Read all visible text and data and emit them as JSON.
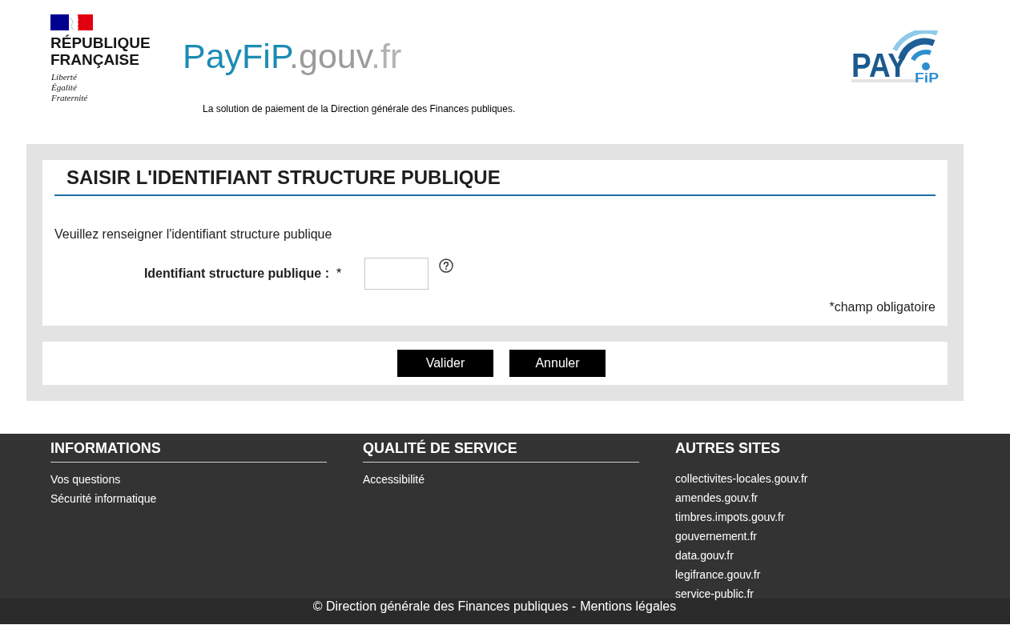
{
  "header": {
    "emblem": {
      "name_lines": [
        "RÉPUBLIQUE",
        "FRANÇAISE"
      ],
      "motto_lines": [
        "Liberté",
        "Égalité",
        "Fraternité"
      ]
    },
    "wordmark": [
      {
        "text": "PayFiP",
        "color": "#1b8cb3"
      },
      {
        "text": ".gouv",
        "color": "#9b9b9b"
      },
      {
        "text": ".fr",
        "color": "#b3b3b3"
      }
    ],
    "tagline": "La solution de paiement de la Direction générale des Finances publiques.",
    "logo": {
      "main": "PAY",
      "sub": "FiP"
    }
  },
  "form": {
    "title": "SAISIR L'IDENTIFIANT STRUCTURE PUBLIQUE",
    "intro": "Veuillez renseigner l'identifiant structure publique",
    "field": {
      "label": "Identifiant structure publique :",
      "required_mark": "*"
    },
    "required_note": "*champ obligatoire"
  },
  "buttons": [
    {
      "label": "Valider"
    },
    {
      "label": "Annuler"
    }
  ],
  "footer": {
    "columns": [
      {
        "title": "INFORMATIONS",
        "links": [
          "Vos questions",
          "Sécurité informatique"
        ]
      },
      {
        "title": "QUALITÉ DE SERVICE",
        "links": [
          "Accessibilité"
        ]
      },
      {
        "title": "AUTRES SITES",
        "links": [
          "collectivites-locales.gouv.fr",
          "amendes.gouv.fr",
          "timbres.impots.gouv.fr",
          "gouvernement.fr",
          "data.gouv.fr",
          "legifrance.gouv.fr",
          "service-public.fr"
        ]
      }
    ],
    "copyright": "© Direction générale des Finances publiques -",
    "legal_link": "Mentions légales"
  }
}
